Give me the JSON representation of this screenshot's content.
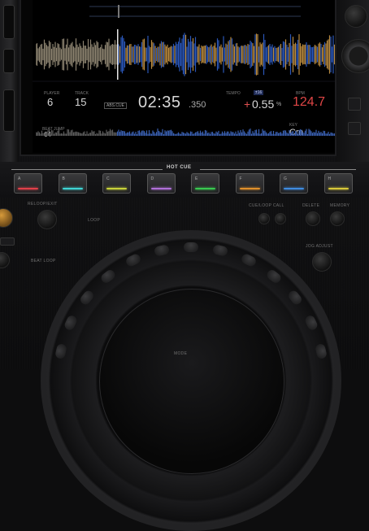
{
  "screen": {
    "fields": {
      "player_label": "PLAYER",
      "player_value": "6",
      "track_label": "TRACK",
      "track_value": "15",
      "mode": "ABS.CUE",
      "time_value": "02:35",
      "time_decimals": ".350",
      "tempo_label": "TEMPO",
      "tempo_range": "±16",
      "tempo_value": "0.55",
      "tempo_unit": "%",
      "bpm_label": "BPM",
      "bpm_value": "124.7",
      "beat_label": "BEAT JUMP",
      "beat_value": "64",
      "key_label": "KEY",
      "key_value": "Cm"
    }
  },
  "hot_cue": {
    "title": "HOT CUE",
    "pads": [
      {
        "letter": "A",
        "color": "#e0404a"
      },
      {
        "letter": "B",
        "color": "#3fd4d4"
      },
      {
        "letter": "C",
        "color": "#c8d23a"
      },
      {
        "letter": "D",
        "color": "#b070d8"
      },
      {
        "letter": "E",
        "color": "#39c850"
      },
      {
        "letter": "F",
        "color": "#e0902c"
      },
      {
        "letter": "G",
        "color": "#3f8ce0"
      },
      {
        "letter": "H",
        "color": "#d8c83a"
      }
    ]
  },
  "controls": {
    "reloop_exit": "RELOOP/EXIT",
    "loop_out": "LOOP",
    "cue_loop_call": "CUE/LOOP CALL",
    "delete": "DELETE",
    "memory": "MEMORY",
    "beat_loop": "BEAT LOOP",
    "jog_adjust": "JOG ADJUST",
    "mode": "MODE"
  }
}
